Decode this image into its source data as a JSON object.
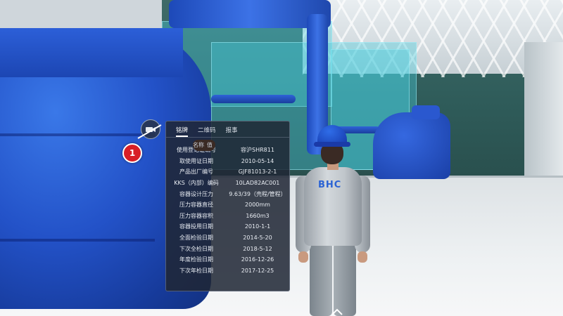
{
  "panel": {
    "tabs": [
      {
        "label": "铭牌",
        "active": true
      },
      {
        "label": "二维码",
        "active": false
      },
      {
        "label": "报事",
        "active": false
      }
    ],
    "columns": {
      "name": "名称",
      "value": "值"
    },
    "rows": [
      {
        "name": "使用登记证编号",
        "value": "容沪SHR811"
      },
      {
        "name": "取使用证日期",
        "value": "2010-05-14"
      },
      {
        "name": "产品出厂编号",
        "value": "GJF81013-2-1"
      },
      {
        "name": "KKS（内部）编码",
        "value": "10LAD82AC001"
      },
      {
        "name": "容器设计压力",
        "value": "9.63/39（壳程/管程）"
      },
      {
        "name": "压力容器直径",
        "value": "2000mm"
      },
      {
        "name": "压力容器容积",
        "value": "1660m3"
      },
      {
        "name": "容器投用日期",
        "value": "2010-1-1"
      },
      {
        "name": "全面检验日期",
        "value": "2014-5-20"
      },
      {
        "name": "下次全检日期",
        "value": "2018-5-12"
      },
      {
        "name": "年度检验日期",
        "value": "2016-12-26"
      },
      {
        "name": "下次年检日期",
        "value": "2017-12-25"
      }
    ]
  },
  "marker": {
    "number": "1",
    "color": "#d81f26"
  },
  "worker": {
    "logo": "BHC"
  },
  "icons": {
    "device": "camera-icon",
    "nav": "chevron-up-icon"
  },
  "colors": {
    "equipment": "#2352c8",
    "glass": "#46cddc",
    "panel_bg": "#202634"
  }
}
